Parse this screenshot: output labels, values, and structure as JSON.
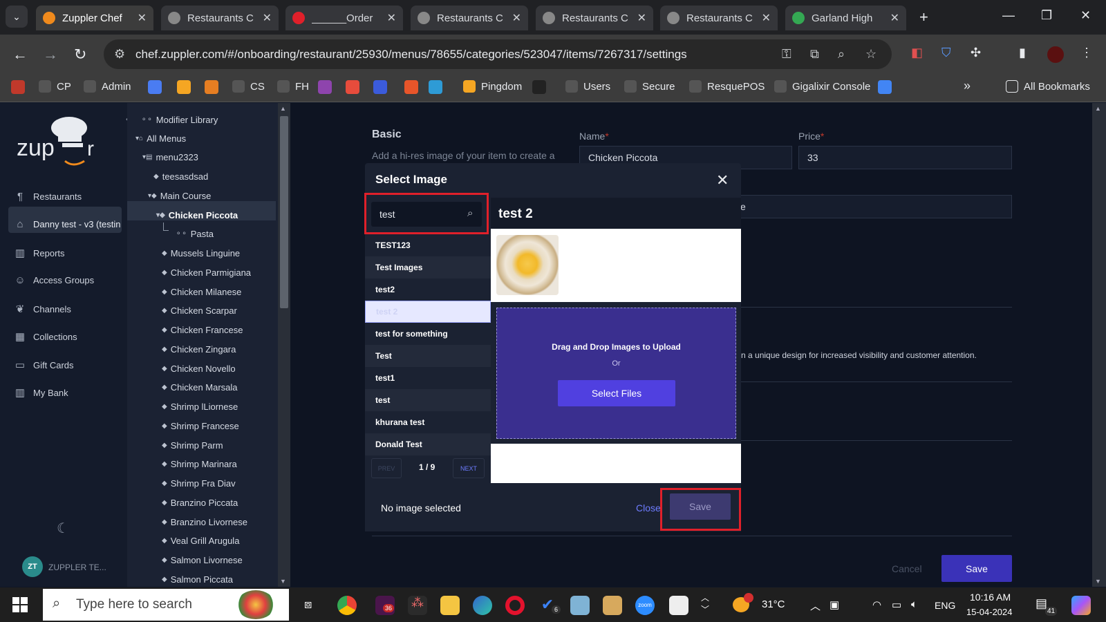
{
  "browser": {
    "tabs": [
      {
        "title": "Zuppler Chef",
        "color": "#f08a1c"
      },
      {
        "title": "Restaurants C",
        "color": "#888888"
      },
      {
        "title": "______Order",
        "color": "#e0202a"
      },
      {
        "title": "Restaurants C",
        "color": "#888888"
      },
      {
        "title": "Restaurants C",
        "color": "#888888"
      },
      {
        "title": "Restaurants C",
        "color": "#888888"
      },
      {
        "title": "Garland High",
        "color": "#34a853"
      }
    ],
    "url": "chef.zuppler.com/#/onboarding/restaurant/25930/menus/78655/categories/523047/items/7267317/settings",
    "bookmarks": [
      "CP",
      "Admin",
      "CS",
      "FH",
      "Pingdom",
      "Users",
      "Secure",
      "ResquePOS",
      "Gigalixir Console",
      "All Bookmarks"
    ]
  },
  "sidebar": {
    "items": [
      {
        "label": "Restaurants",
        "icon": "fork-knife-icon"
      },
      {
        "label": "Danny test - v3 (testin",
        "icon": "home-icon"
      },
      {
        "label": "Reports",
        "icon": "chart-icon"
      },
      {
        "label": "Access Groups",
        "icon": "users-icon"
      },
      {
        "label": "Channels",
        "icon": "leaf-icon"
      },
      {
        "label": "Collections",
        "icon": "collection-icon"
      },
      {
        "label": "Gift Cards",
        "icon": "card-icon"
      },
      {
        "label": "My Bank",
        "icon": "bank-icon"
      }
    ],
    "user_initials": "ZT",
    "user_name": "ZUPPLER TE..."
  },
  "tree": {
    "items": [
      {
        "label": "Modifier Library"
      },
      {
        "label": "All Menus"
      },
      {
        "label": "menu2323"
      },
      {
        "label": "teesasdsad"
      },
      {
        "label": "Main Course"
      },
      {
        "label": "Chicken Piccota"
      },
      {
        "label": "Pasta"
      },
      {
        "label": "Mussels Linguine"
      },
      {
        "label": "Chicken Parmigiana"
      },
      {
        "label": "Chicken Milanese"
      },
      {
        "label": "Chicken Scarpar"
      },
      {
        "label": "Chicken Francese"
      },
      {
        "label": "Chicken Zingara"
      },
      {
        "label": "Chicken Novello"
      },
      {
        "label": "Chicken Marsala"
      },
      {
        "label": "Shrimp lLiornese"
      },
      {
        "label": "Shrimp Francese"
      },
      {
        "label": "Shrimp Parm"
      },
      {
        "label": "Shrimp Marinara"
      },
      {
        "label": "Shrimp Fra Diav"
      },
      {
        "label": "Branzino Piccata"
      },
      {
        "label": "Branzino Livornese"
      },
      {
        "label": "Veal Grill Arugula"
      },
      {
        "label": "Salmon Livornese"
      },
      {
        "label": "Salmon Piccata"
      }
    ]
  },
  "main": {
    "section_title": "Basic",
    "section_desc": "Add a hi-res image of your item to create a",
    "name_label": "Name",
    "name_value": "Chicken Piccota",
    "price_label": "Price",
    "price_value": "33",
    "desc_partial": "e",
    "design_text": "n a unique design for increased visibility and customer attention.",
    "cancel": "Cancel",
    "save": "Save"
  },
  "modal": {
    "title": "Select Image",
    "search_value": "test",
    "results": [
      "TEST123",
      "Test Images",
      "test2",
      "test 2",
      "test for something",
      "Test",
      "test1",
      "test",
      "khurana test",
      "Donald Test"
    ],
    "selected_index": 3,
    "prev": "PREV",
    "next": "NEXT",
    "page": "1 / 9",
    "right_title": "test 2",
    "upload_text": "Drag and Drop Images to Upload",
    "upload_or": "Or",
    "select_files": "Select Files",
    "status": "No image selected",
    "close": "Close",
    "save": "Save"
  },
  "taskbar": {
    "search_placeholder": "Type here to search",
    "weather": "31°C",
    "lang": "ENG",
    "time": "10:16 AM",
    "date": "15-04-2024",
    "notif_count": "41",
    "slack_badge": "36",
    "todo_badge": "6"
  }
}
